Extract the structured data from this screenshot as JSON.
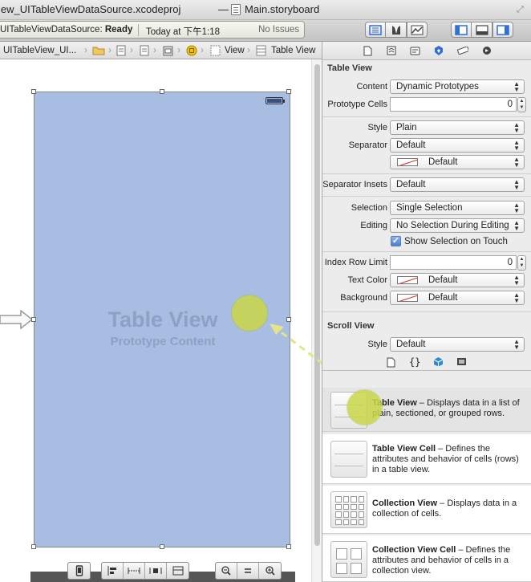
{
  "titlebar": {
    "project": "iew_UITableViewDataSource.xcodeproj",
    "separator": "—",
    "file": "Main.storyboard"
  },
  "toolbar": {
    "status_project": "UITableViewDataSource:",
    "status_state": "Ready",
    "status_time": "Today at 下午1:18",
    "status_issues": "No Issues"
  },
  "jumpbar": {
    "items": [
      "UITableView_UI...",
      "View",
      "Table View"
    ]
  },
  "canvas": {
    "scene_title": "Table View",
    "scene_subtitle": "Prototype Content"
  },
  "inspector": {
    "table_view_header": "Table View",
    "content_label": "Content",
    "content_value": "Dynamic Prototypes",
    "prototype_cells_label": "Prototype Cells",
    "prototype_cells_value": "0",
    "style_label": "Style",
    "style_value": "Plain",
    "separator_label": "Separator",
    "separator_value": "Default",
    "separator_color_value": "Default",
    "separator_insets_label": "Separator Insets",
    "separator_insets_value": "Default",
    "selection_label": "Selection",
    "selection_value": "Single Selection",
    "editing_label": "Editing",
    "editing_value": "No Selection During Editing",
    "show_selection_label": "Show Selection on Touch",
    "index_row_limit_label": "Index Row Limit",
    "index_row_limit_value": "0",
    "text_color_label": "Text Color",
    "text_color_value": "Default",
    "background_label": "Background",
    "background_value": "Default",
    "scroll_view_header": "Scroll View",
    "scroll_style_label": "Style",
    "scroll_style_value": "Default"
  },
  "library": {
    "items": [
      {
        "title": "Table View",
        "desc": " – Displays data in a list of plain, sectioned, or grouped rows."
      },
      {
        "title": "Table View Cell",
        "desc": " – Defines the attributes and behavior of cells (rows) in a table view."
      },
      {
        "title": "Collection View",
        "desc": " – Displays data in a collection of cells."
      },
      {
        "title": "Collection View Cell",
        "desc": " – Defines the attributes and behavior of cells in a collection view."
      }
    ]
  },
  "colors": {
    "scene_background": "#a7bde2",
    "touch_indicator": "#c8d746",
    "accent_blue": "#2f6fd6"
  }
}
